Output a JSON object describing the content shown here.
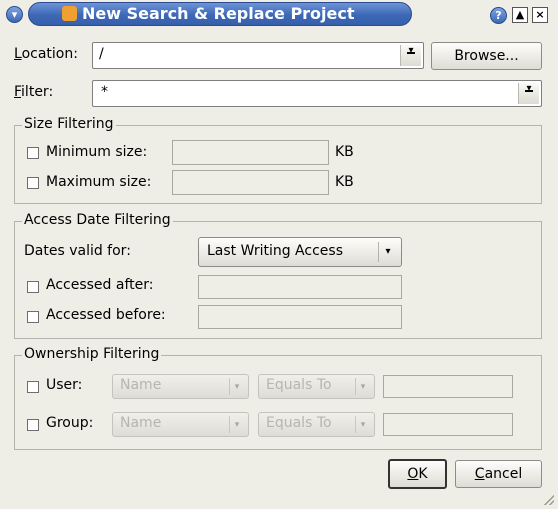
{
  "window": {
    "title": "New Search & Replace Project",
    "help_glyph": "?",
    "shade_glyph": "▲",
    "close_glyph": "×",
    "menu_glyph": "▾"
  },
  "location": {
    "label_first": "L",
    "label_rest": "ocation:",
    "value": "/",
    "browse_label": "Browse..."
  },
  "filter": {
    "label_first": "F",
    "label_rest": "ilter:",
    "value": "*"
  },
  "size_filtering": {
    "title": "Size Filtering",
    "min_label": "Minimum size:",
    "max_label": "Maximum size:",
    "min_unit": "KB",
    "max_unit": "KB"
  },
  "access_date_filtering": {
    "title": "Access Date Filtering",
    "dates_valid_label": "Dates valid for:",
    "dates_valid_value": "Last Writing Access",
    "after_label": "Accessed after:",
    "before_label": "Accessed before:"
  },
  "ownership_filtering": {
    "title": "Ownership Filtering",
    "user_label": "User:",
    "group_label": "Group:",
    "user_name_placeholder": "Name",
    "user_op": "Equals To",
    "group_name_placeholder": "Name",
    "group_op": "Equals To"
  },
  "buttons": {
    "ok_first": "O",
    "ok_rest": "K",
    "cancel_first": "C",
    "cancel_rest": "ancel"
  },
  "icons": {
    "dropdown": "dropdown-arrow-icon",
    "app": "app-icon"
  },
  "colors": {
    "title_bar": "#3d68b6",
    "background": "#eeeee6"
  }
}
